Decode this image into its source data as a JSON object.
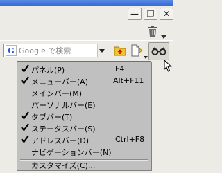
{
  "window": {
    "minimize_glyph": "—",
    "restore_glyph": "❐",
    "close_glyph": "✕"
  },
  "toolbar": {
    "search_placeholder": "Google で検索",
    "google_glyph": "G"
  },
  "menu": {
    "items": [
      {
        "label": "パネル(P)",
        "shortcut": "F4",
        "checked": true
      },
      {
        "label": "メニューバー(A)",
        "shortcut": "Alt+F11",
        "checked": true
      },
      {
        "label": "メインバー(M)",
        "shortcut": "",
        "checked": false
      },
      {
        "label": "パーソナルバー(E)",
        "shortcut": "",
        "checked": false
      },
      {
        "label": "タブバー(T)",
        "shortcut": "",
        "checked": true
      },
      {
        "label": "ステータスバー(S)",
        "shortcut": "",
        "checked": true
      },
      {
        "label": "アドレスバー(D)",
        "shortcut": "Ctrl+F8",
        "checked": true
      },
      {
        "label": "ナビゲーションバー(N)",
        "shortcut": "",
        "checked": false
      }
    ],
    "customize_label": "カスタマイズ(C)..."
  }
}
